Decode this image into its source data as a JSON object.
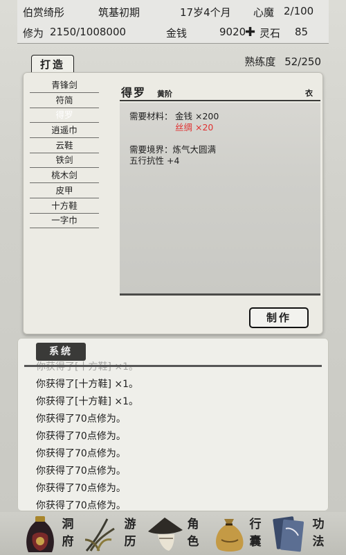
{
  "status": {
    "player_name": "伯赏绮彤",
    "realm": "筑基初期",
    "age": "17岁4个月",
    "heart_demon_label": "心魔",
    "heart_demon_value": "2/100",
    "cultivation_label": "修为",
    "cultivation_value": "2150/1008000",
    "money_label": "金钱",
    "money_value": "9020",
    "spirit_stone_label": "灵石",
    "spirit_stone_value": "85",
    "spirit_stone_icon": "plus-cross-icon"
  },
  "craft": {
    "tab_label": "打造",
    "proficiency_label": "熟练度",
    "proficiency_value": "52/250",
    "items": [
      "青锋剑",
      "符简",
      "得罗",
      "逍遥巾",
      "云鞋",
      "铁剑",
      "桃木剑",
      "皮甲",
      "十方鞋",
      "一字巾"
    ],
    "selected_index": 2,
    "detail": {
      "name": "得罗",
      "grade": "黄阶",
      "type": "衣",
      "materials_label": "需要材料：",
      "material_1": "金钱  ×200",
      "material_2": "丝绸  ×20",
      "material_2_color": "#e03030",
      "realm_req": "需要境界：炼气大圆满",
      "effect": "五行抗性 +4"
    },
    "make_button": "制作"
  },
  "log": {
    "tab_label": "系统",
    "lines": [
      "你获得了[十方鞋] ×1。",
      "你获得了[十方鞋] ×1。",
      "你获得了[十方鞋] ×1。",
      "你获得了70点修为。",
      "你获得了70点修为。",
      "你获得了70点修为。",
      "你获得了70点修为。",
      "你获得了70点修为。",
      "你获得了70点修为。"
    ]
  },
  "nav": [
    {
      "id": "cave",
      "label": "洞府",
      "icon": "cave-bag-icon"
    },
    {
      "id": "travel",
      "label": "游历",
      "icon": "reed-grass-icon"
    },
    {
      "id": "character",
      "label": "角色",
      "icon": "straw-hat-icon"
    },
    {
      "id": "bag",
      "label": "行囊",
      "icon": "sack-icon"
    },
    {
      "id": "skills",
      "label": "功法",
      "icon": "scroll-books-icon"
    }
  ]
}
